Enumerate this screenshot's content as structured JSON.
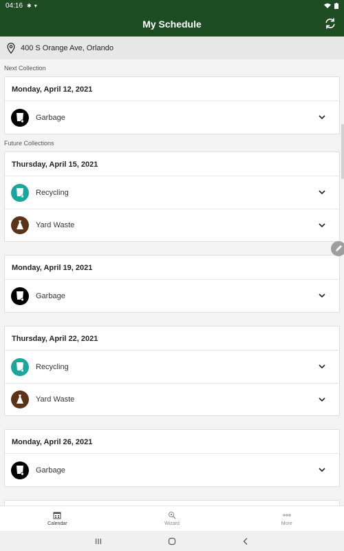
{
  "status_bar": {
    "time": "04:16"
  },
  "app_bar": {
    "title": "My Schedule"
  },
  "address": {
    "text": "400 S Orange Ave, Orlando"
  },
  "sections": {
    "next_label": "Next Collection",
    "future_label": "Future Collections"
  },
  "collections": [
    {
      "date": "Monday, April 12, 2021",
      "items": [
        {
          "label": "Garbage",
          "icon": "garbage-cart-icon"
        }
      ]
    },
    {
      "date": "Thursday, April 15, 2021",
      "items": [
        {
          "label": "Recycling",
          "icon": "recycling-cart-icon"
        },
        {
          "label": "Yard Waste",
          "icon": "yard-waste-bag-icon"
        }
      ]
    },
    {
      "date": "Monday, April 19, 2021",
      "items": [
        {
          "label": "Garbage",
          "icon": "garbage-cart-icon"
        }
      ]
    },
    {
      "date": "Thursday, April 22, 2021",
      "items": [
        {
          "label": "Recycling",
          "icon": "recycling-cart-icon"
        },
        {
          "label": "Yard Waste",
          "icon": "yard-waste-bag-icon"
        }
      ]
    },
    {
      "date": "Monday, April 26, 2021",
      "items": [
        {
          "label": "Garbage",
          "icon": "garbage-cart-icon"
        }
      ]
    }
  ],
  "bottom_nav": [
    {
      "label": "Calendar",
      "icon": "calendar-icon",
      "active": true
    },
    {
      "label": "Wizard",
      "icon": "wizard-search-icon",
      "active": false
    },
    {
      "label": "More",
      "icon": "more-dots-icon",
      "active": false
    }
  ],
  "colors": {
    "header_green": "#1f4d23",
    "garbage": "#000000",
    "recycling": "#1aa69a",
    "yard_waste": "#5c3317"
  }
}
